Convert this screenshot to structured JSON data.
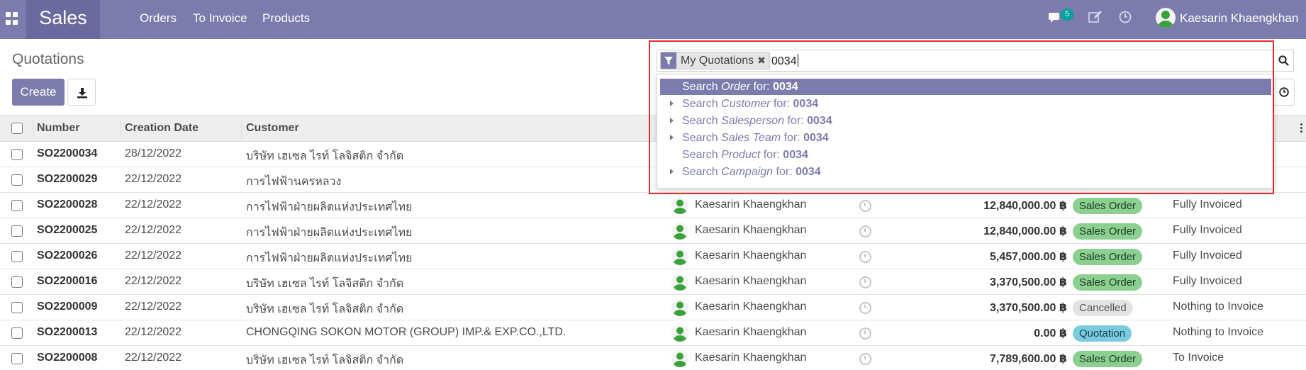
{
  "navbar": {
    "app_name": "Sales",
    "menu": [
      "Orders",
      "To Invoice",
      "Products"
    ],
    "messages_count": "5",
    "user_name": "Kaesarin Khaengkhan"
  },
  "control_panel": {
    "breadcrumb": "Quotations",
    "create_label": "Create"
  },
  "search": {
    "facet_label": "My Quotations",
    "query": "0034",
    "suggestions": [
      {
        "prefix": "Search ",
        "field": "Order",
        "suffix": " for: ",
        "term": "0034",
        "expandable": false,
        "active": true
      },
      {
        "prefix": "Search ",
        "field": "Customer",
        "suffix": " for: ",
        "term": "0034",
        "expandable": true,
        "active": false
      },
      {
        "prefix": "Search ",
        "field": "Salesperson",
        "suffix": " for: ",
        "term": "0034",
        "expandable": true,
        "active": false
      },
      {
        "prefix": "Search ",
        "field": "Sales Team",
        "suffix": " for: ",
        "term": "0034",
        "expandable": true,
        "active": false
      },
      {
        "prefix": "Search ",
        "field": "Product",
        "suffix": " for: ",
        "term": "0034",
        "expandable": false,
        "active": false
      },
      {
        "prefix": "Search ",
        "field": "Campaign",
        "suffix": " for: ",
        "term": "0034",
        "expandable": true,
        "active": false
      }
    ]
  },
  "table": {
    "columns": [
      "Number",
      "Creation Date",
      "Customer"
    ],
    "rows": [
      {
        "number": "SO2200034",
        "date": "28/12/2022",
        "customer": "บริษัท เฮเซล ไรท์ โลจิสติก จำกัด",
        "salesperson": "",
        "amount": "",
        "status": "",
        "status_kind": "",
        "invoice_status": ""
      },
      {
        "number": "SO2200029",
        "date": "22/12/2022",
        "customer": "การไฟฟ้านครหลวง",
        "salesperson": "",
        "amount": "",
        "status": "",
        "status_kind": "",
        "invoice_status": ""
      },
      {
        "number": "SO2200028",
        "date": "22/12/2022",
        "customer": "การไฟฟ้าฝ่ายผลิตแห่งประเทศไทย",
        "salesperson": "Kaesarin Khaengkhan",
        "amount": "12,840,000.00 ฿",
        "status": "Sales Order",
        "status_kind": "so",
        "invoice_status": "Fully Invoiced"
      },
      {
        "number": "SO2200025",
        "date": "22/12/2022",
        "customer": "การไฟฟ้าฝ่ายผลิตแห่งประเทศไทย",
        "salesperson": "Kaesarin Khaengkhan",
        "amount": "12,840,000.00 ฿",
        "status": "Sales Order",
        "status_kind": "so",
        "invoice_status": "Fully Invoiced"
      },
      {
        "number": "SO2200026",
        "date": "22/12/2022",
        "customer": "การไฟฟ้าฝ่ายผลิตแห่งประเทศไทย",
        "salesperson": "Kaesarin Khaengkhan",
        "amount": "5,457,000.00 ฿",
        "status": "Sales Order",
        "status_kind": "so",
        "invoice_status": "Fully Invoiced"
      },
      {
        "number": "SO2200016",
        "date": "22/12/2022",
        "customer": "บริษัท เฮเซล ไรท์ โลจิสติก จำกัด",
        "salesperson": "Kaesarin Khaengkhan",
        "amount": "3,370,500.00 ฿",
        "status": "Sales Order",
        "status_kind": "so",
        "invoice_status": "Fully Invoiced"
      },
      {
        "number": "SO2200009",
        "date": "22/12/2022",
        "customer": "บริษัท เฮเซล ไรท์ โลจิสติก จำกัด",
        "salesperson": "Kaesarin Khaengkhan",
        "amount": "3,370,500.00 ฿",
        "status": "Cancelled",
        "status_kind": "cancel",
        "invoice_status": "Nothing to Invoice"
      },
      {
        "number": "SO2200013",
        "date": "22/12/2022",
        "customer": "CHONGQING SOKON MOTOR (GROUP) IMP.& EXP.CO.,LTD.",
        "salesperson": "Kaesarin Khaengkhan",
        "amount": "0.00 ฿",
        "status": "Quotation",
        "status_kind": "quote",
        "invoice_status": "Nothing to Invoice"
      },
      {
        "number": "SO2200008",
        "date": "22/12/2022",
        "customer": "บริษัท เฮเซล ไรท์ โลจิสติก จำกัด",
        "salesperson": "Kaesarin Khaengkhan",
        "amount": "7,789,600.00 ฿",
        "status": "Sales Order",
        "status_kind": "so",
        "invoice_status": "To Invoice"
      }
    ]
  },
  "colors": {
    "brand": "#7c7bad",
    "brand_dark": "#6b6aa0",
    "badge_sales_order": "#8bcf91",
    "badge_cancelled": "#e3e3e3",
    "badge_quotation": "#7bcbdf",
    "highlight_frame": "#e52b2b"
  },
  "icons": [
    "apps-grid-icon",
    "chat-icon",
    "edit-icon",
    "clock-icon",
    "user-avatar-icon",
    "download-icon",
    "filter-icon",
    "remove-facet-icon",
    "search-icon",
    "kebab-menu-icon",
    "activity-clock-icon",
    "expand-triangle-icon"
  ]
}
